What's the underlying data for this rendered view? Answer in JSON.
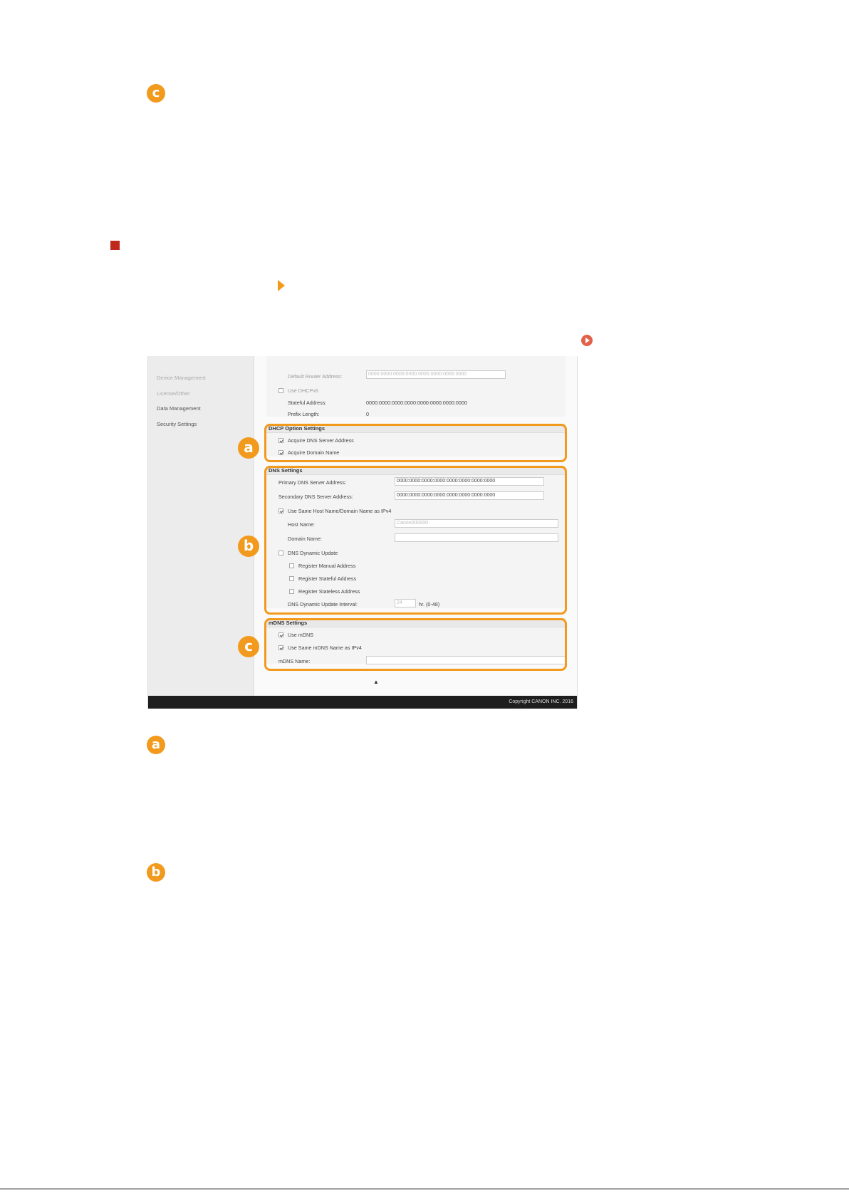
{
  "markers": {
    "badge_c_top": "c",
    "badge_a": "a",
    "badge_b": "b",
    "badge_c": "c"
  },
  "sidebar": {
    "items": [
      {
        "label": "Device Management"
      },
      {
        "label": "License/Other"
      },
      {
        "label": "Data Management"
      },
      {
        "label": "Security Settings"
      }
    ]
  },
  "ipv6_top": {
    "default_router_label": "Default Router Address:",
    "default_router_value": "0000:0000:0000:0000:0000:0000:0000:0000",
    "use_dhcpv6_label": "Use DHCPv6",
    "stateful_label": "Stateful Address:",
    "stateful_value": "0000:0000:0000:0000:0000:0000:0000:0000",
    "prefix_label": "Prefix Length:",
    "prefix_value": "0"
  },
  "dhcp_option": {
    "heading": "DHCP Option Settings",
    "acquire_dns_label": "Acquire DNS Server Address",
    "acquire_domain_label": "Acquire Domain Name"
  },
  "dns": {
    "heading": "DNS Settings",
    "primary_label": "Primary DNS Server Address:",
    "primary_value": "0000:0000:0000:0000:0000:0000:0000:0000",
    "secondary_label": "Secondary DNS Server Address:",
    "secondary_value": "0000:0000:0000:0000:0000:0000:0000:0000",
    "same_host_label": "Use Same Host Name/Domain Name as IPv4",
    "host_name_label": "Host Name:",
    "host_name_value": "Canon000000",
    "domain_name_label": "Domain Name:",
    "domain_name_value": "",
    "dynamic_update_label": "DNS Dynamic Update",
    "register_manual_label": "Register Manual Address",
    "register_stateful_label": "Register Stateful Address",
    "register_stateless_label": "Register Stateless Address",
    "interval_label": "DNS Dynamic Update Interval:",
    "interval_value": "24",
    "interval_unit": "hr. (0-48)"
  },
  "mdns": {
    "heading": "mDNS Settings",
    "use_mdns_label": "Use mDNS",
    "same_mdns_label": "Use Same mDNS Name as IPv4",
    "mdns_name_label": "mDNS Name:",
    "mdns_name_value": ""
  },
  "footer": {
    "copyright": "Copyright CANON INC. 2016"
  },
  "colors": {
    "accent_orange": "#f29a1d",
    "marker_red": "#c0281e",
    "footer_bg": "#1e1e1e"
  }
}
